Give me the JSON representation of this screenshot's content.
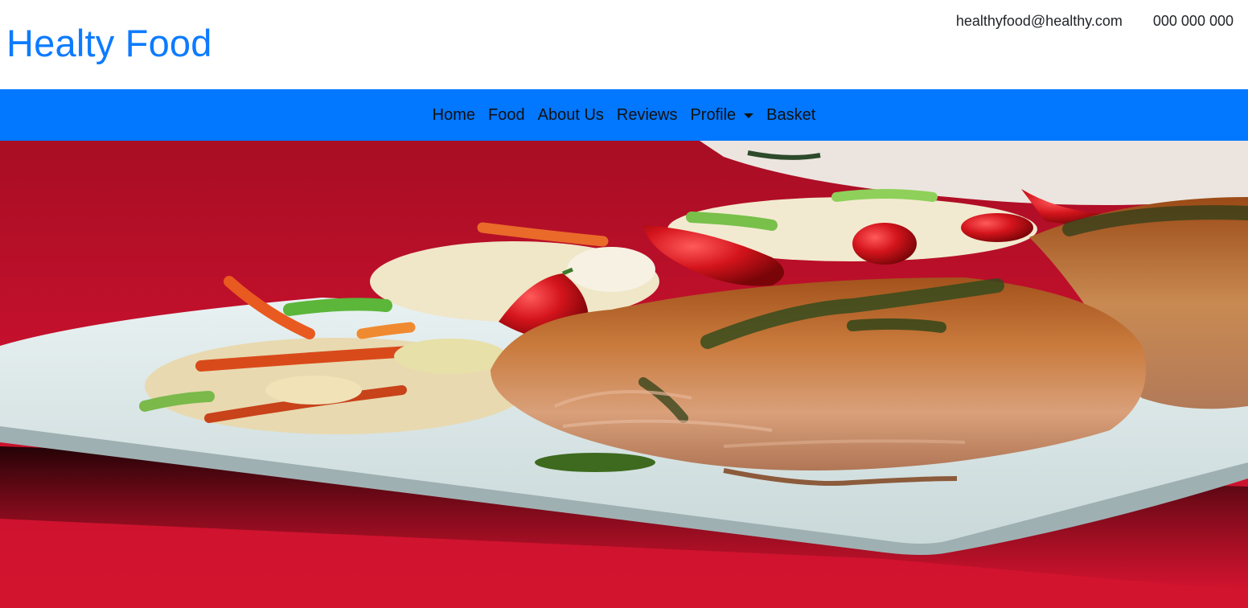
{
  "header": {
    "brand": "Healty Food",
    "email": "healthyfood@healthy.com",
    "phone": "000 000 000"
  },
  "nav": {
    "items": [
      {
        "label": "Home"
      },
      {
        "label": "Food"
      },
      {
        "label": "About Us"
      },
      {
        "label": "Reviews"
      },
      {
        "label": "Profile",
        "dropdown": true
      },
      {
        "label": "Basket"
      }
    ]
  },
  "hero": {
    "image": "grilled salmon fillets with vegetable slaw and red chili peppers on a white plate on a red tablecloth"
  },
  "colors": {
    "brand": "#0d7bff",
    "navbar": "#0277ff",
    "tablecloth": "#c8102e"
  }
}
